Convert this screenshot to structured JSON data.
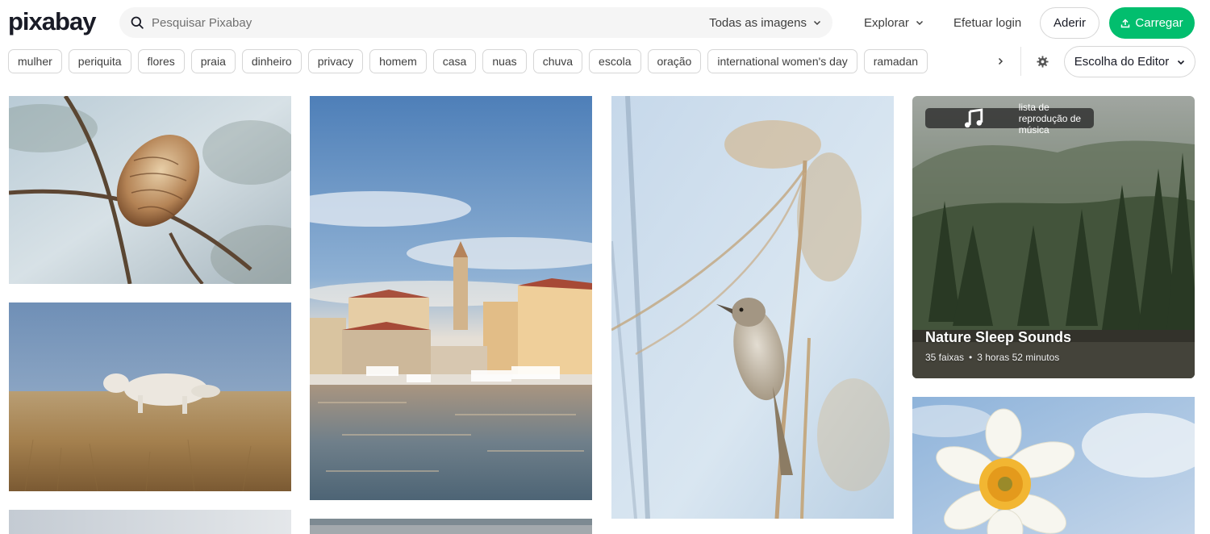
{
  "header": {
    "logo_text": "pixabay",
    "search": {
      "placeholder": "Pesquisar Pixabay",
      "value": "",
      "type_selected": "Todas as imagens"
    },
    "explore_label": "Explorar",
    "login_label": "Efetuar login",
    "join_label": "Aderir",
    "upload_label": "Carregar"
  },
  "tags": [
    "mulher",
    "periquita",
    "flores",
    "praia",
    "dinheiro",
    "privacy",
    "homem",
    "casa",
    "nuas",
    "chuva",
    "escola",
    "oração",
    "international women's day",
    "ramadan"
  ],
  "filter": {
    "sort_selected": "Escolha do Editor"
  },
  "playlist": {
    "badge": "lista de reprodução de música",
    "title": "Nature Sleep Sounds",
    "tracks": "35 faixas",
    "separator": "•",
    "duration": "3 horas 52 minutos"
  },
  "colors": {
    "brand_green": "#02be6e",
    "text": "#191b26"
  },
  "icons": {
    "search": "search-icon",
    "chevron": "chevron-down-icon",
    "next": "chevron-right-icon",
    "gear": "gear-icon",
    "upload": "upload-icon",
    "note": "music-note-icon"
  }
}
